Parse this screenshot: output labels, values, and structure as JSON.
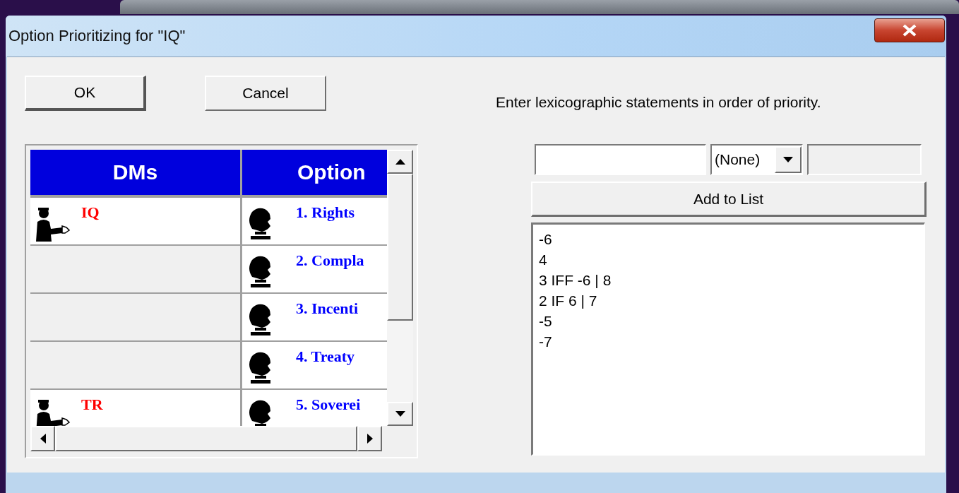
{
  "window": {
    "title": "Option Prioritizing for \"IQ\""
  },
  "buttons": [
    {
      "label": "OK",
      "default": true
    },
    {
      "label": "Cancel",
      "default": false
    }
  ],
  "table": {
    "columns": [
      "DMs",
      "Option"
    ],
    "rows": [
      {
        "dm": "IQ",
        "option": "1. Rights"
      },
      {
        "option": "2. Compla"
      },
      {
        "option": "3. Incenti"
      },
      {
        "option": "4. Treaty"
      },
      {
        "dm": "TR",
        "option": "5. Soverei"
      }
    ]
  },
  "instruction": "Enter lexicographic statements in order of priority.",
  "condition_dropdown": {
    "value": "(None)"
  },
  "second_field": {
    "disabled": true
  },
  "add_button": "Add to List",
  "statements": [
    "-6",
    "4",
    "3 IFF -6 | 8",
    "2 IF 6 | 7",
    "-5",
    "-7"
  ]
}
